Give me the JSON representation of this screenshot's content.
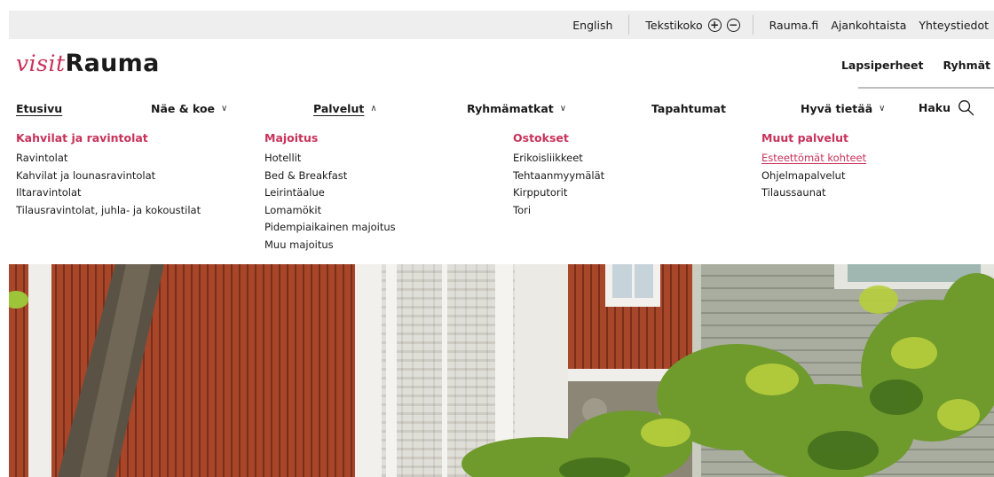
{
  "utility": {
    "language": "English",
    "text_size_label": "Tekstikoko",
    "increase_symbol": "+",
    "decrease_symbol": "−",
    "links": [
      "Rauma.fi",
      "Ajankohtaista",
      "Yhteystiedot"
    ]
  },
  "logo": {
    "visit": "visit",
    "rauma": "Rauma"
  },
  "audience": [
    "Lapsiperheet",
    "Ryhmät"
  ],
  "nav": {
    "items": [
      {
        "label": "Etusivu",
        "chevron": ""
      },
      {
        "label": "Näe & koe",
        "chevron": "∨"
      },
      {
        "label": "Palvelut",
        "chevron": "∧"
      },
      {
        "label": "Ryhmämatkat",
        "chevron": "∨"
      },
      {
        "label": "Tapahtumat",
        "chevron": ""
      },
      {
        "label": "Hyvä tietää",
        "chevron": "∨"
      }
    ],
    "search_label": "Haku"
  },
  "mega": {
    "columns": [
      {
        "heading": "Kahvilat ja ravintolat",
        "links": [
          "Ravintolat",
          "Kahvilat ja lounasravintolat",
          "Iltaravintolat",
          "Tilausravintolat, juhla- ja kokoustilat"
        ]
      },
      {
        "heading": "Majoitus",
        "links": [
          "Hotellit",
          "Bed & Breakfast",
          "Leirintäalue",
          "Lomamökit",
          "Pidempiaikainen majoitus",
          "Muu majoitus"
        ]
      },
      {
        "heading": "Ostokset",
        "links": [
          "Erikoisliikkeet",
          "Tehtaanmyymälät",
          "Kirpputorit",
          "Tori"
        ]
      },
      {
        "heading": "Muut palvelut",
        "links": [
          "Esteettömät kohteet",
          "Ohjelmapalvelut",
          "Tilaussaunat"
        ]
      }
    ]
  },
  "colors": {
    "accent": "#c8325a",
    "utility_bg": "#eeeeee",
    "text": "#1a1a1a"
  },
  "icons": {
    "plus": "plus-circle-icon",
    "minus": "minus-circle-icon",
    "search": "search-icon",
    "chevron_down": "chevron-down-icon",
    "chevron_up": "chevron-up-icon"
  }
}
